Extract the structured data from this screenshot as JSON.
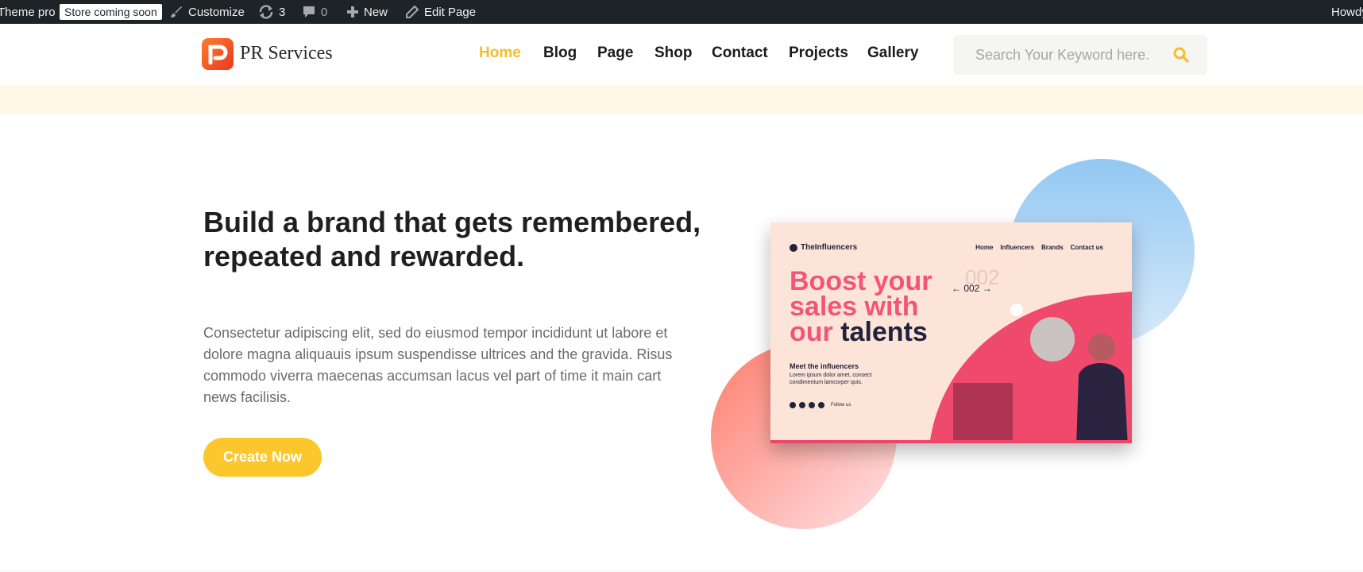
{
  "adminbar": {
    "site": "Theme pro",
    "badge": "Store coming soon",
    "customize": "Customize",
    "updates_count": "3",
    "comments_count": "0",
    "new": "New",
    "edit_page": "Edit Page",
    "howdy": "Howdy"
  },
  "header": {
    "logo_text": "PR Services",
    "nav": [
      "Home",
      "Blog",
      "Page",
      "Shop",
      "Contact",
      "Projects",
      "Gallery"
    ],
    "active_nav": "Home",
    "search_placeholder": "Search Your Keyword here."
  },
  "hero": {
    "title": "Build a brand that gets remembered, repeated and rewarded.",
    "description": "Consectetur adipiscing elit, sed do eiusmod tempor incididunt ut labore et dolore magna aliquauis ipsum suspendisse ultrices and the gravida. Risus commodo viverra maecenas accumsan lacus vel part of time it main cart news facilisis.",
    "cta": "Create Now"
  },
  "illustration": {
    "brand": "TheInfluencers",
    "nav": [
      "Home",
      "Influencers",
      "Brands",
      "Contact us"
    ],
    "headline_line1": "Boost your",
    "headline_line2": "sales with",
    "headline_line3_a": "our ",
    "headline_line3_b": "talents",
    "counter": "← 002 →",
    "counter_ghost": "002",
    "meet_title": "Meet the influencers",
    "meet_text": "Lorem ipsum dolor amet, consect condimentum lamcorper quis.",
    "social_label": "Follow us"
  },
  "colors": {
    "accent": "#fcc72c",
    "nav_active": "#f6bd2a",
    "adminbar": "#1d2327",
    "card_pink": "#f2557a",
    "card_dark": "#22223a"
  }
}
